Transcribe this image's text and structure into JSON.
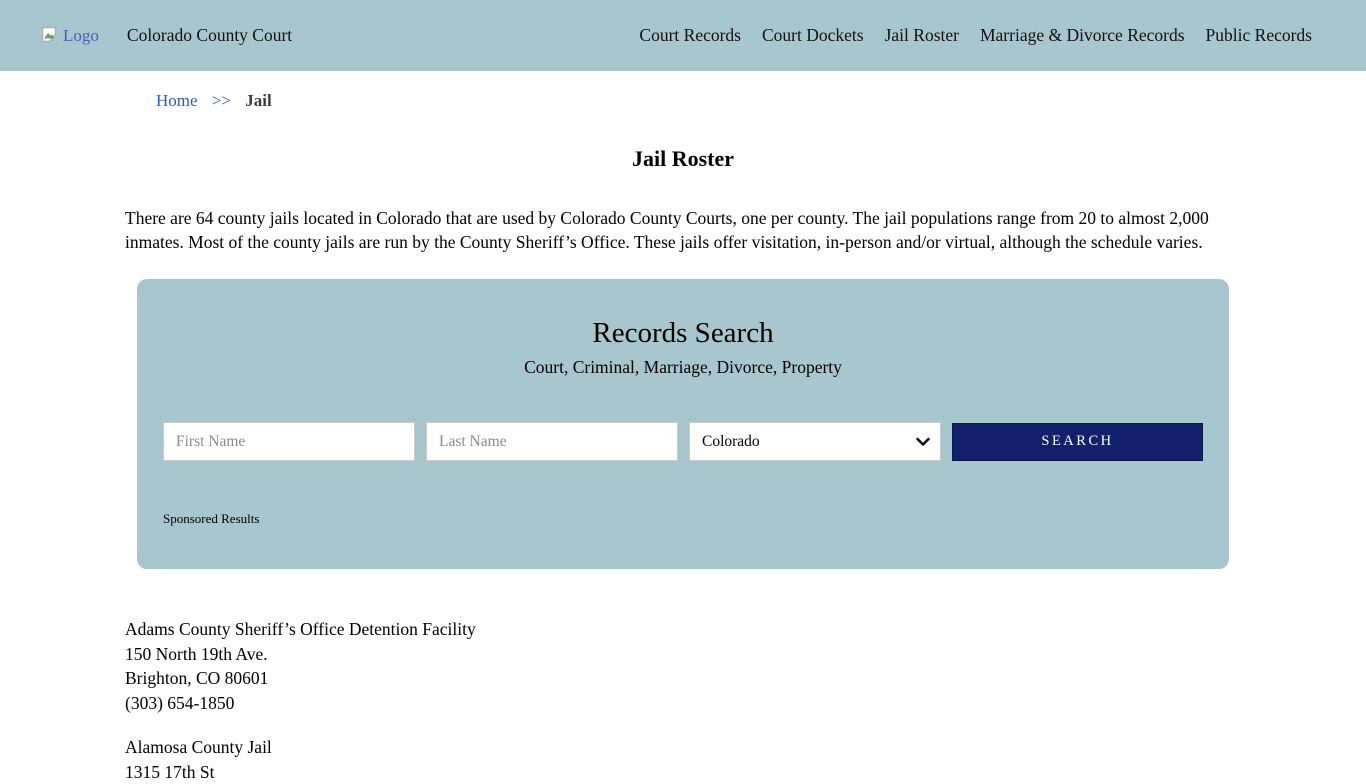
{
  "header": {
    "logo_alt": "Logo",
    "site_title": "Colorado County Court",
    "nav": [
      {
        "label": "Court Records"
      },
      {
        "label": "Court Dockets"
      },
      {
        "label": "Jail Roster"
      },
      {
        "label": "Marriage & Divorce Records"
      },
      {
        "label": "Public Records"
      }
    ]
  },
  "breadcrumb": {
    "home": "Home",
    "separator": ">>",
    "current": "Jail"
  },
  "page": {
    "title": "Jail Roster",
    "intro": "There are 64 county jails located in Colorado that are used by Colorado County Courts, one per county. The jail populations range from 20 to almost 2,000 inmates. Most of the county jails are run by the County Sheriff’s Office. These jails offer visitation, in-person and/or virtual, although the schedule varies."
  },
  "search": {
    "title": "Records Search",
    "subtitle": "Court, Criminal, Marriage, Divorce, Property",
    "first_name_placeholder": "First Name",
    "last_name_placeholder": "Last Name",
    "state_selected": "Colorado",
    "search_button": "SEARCH",
    "sponsored_label": "Sponsored Results"
  },
  "jails": [
    {
      "name": "Adams County Sheriff’s Office Detention Facility",
      "address": "150 North 19th Ave.",
      "city": "Brighton, CO 80601",
      "phone": "(303) 654-1850"
    },
    {
      "name": "Alamosa County Jail",
      "address": "1315 17th St"
    }
  ],
  "colors": {
    "header_bg": "#a8c6ce",
    "panel_bg": "#a8c6ce",
    "button_bg": "#13206b",
    "link_blue": "#2a5db2",
    "logo_text_blue": "#3b63c4"
  }
}
